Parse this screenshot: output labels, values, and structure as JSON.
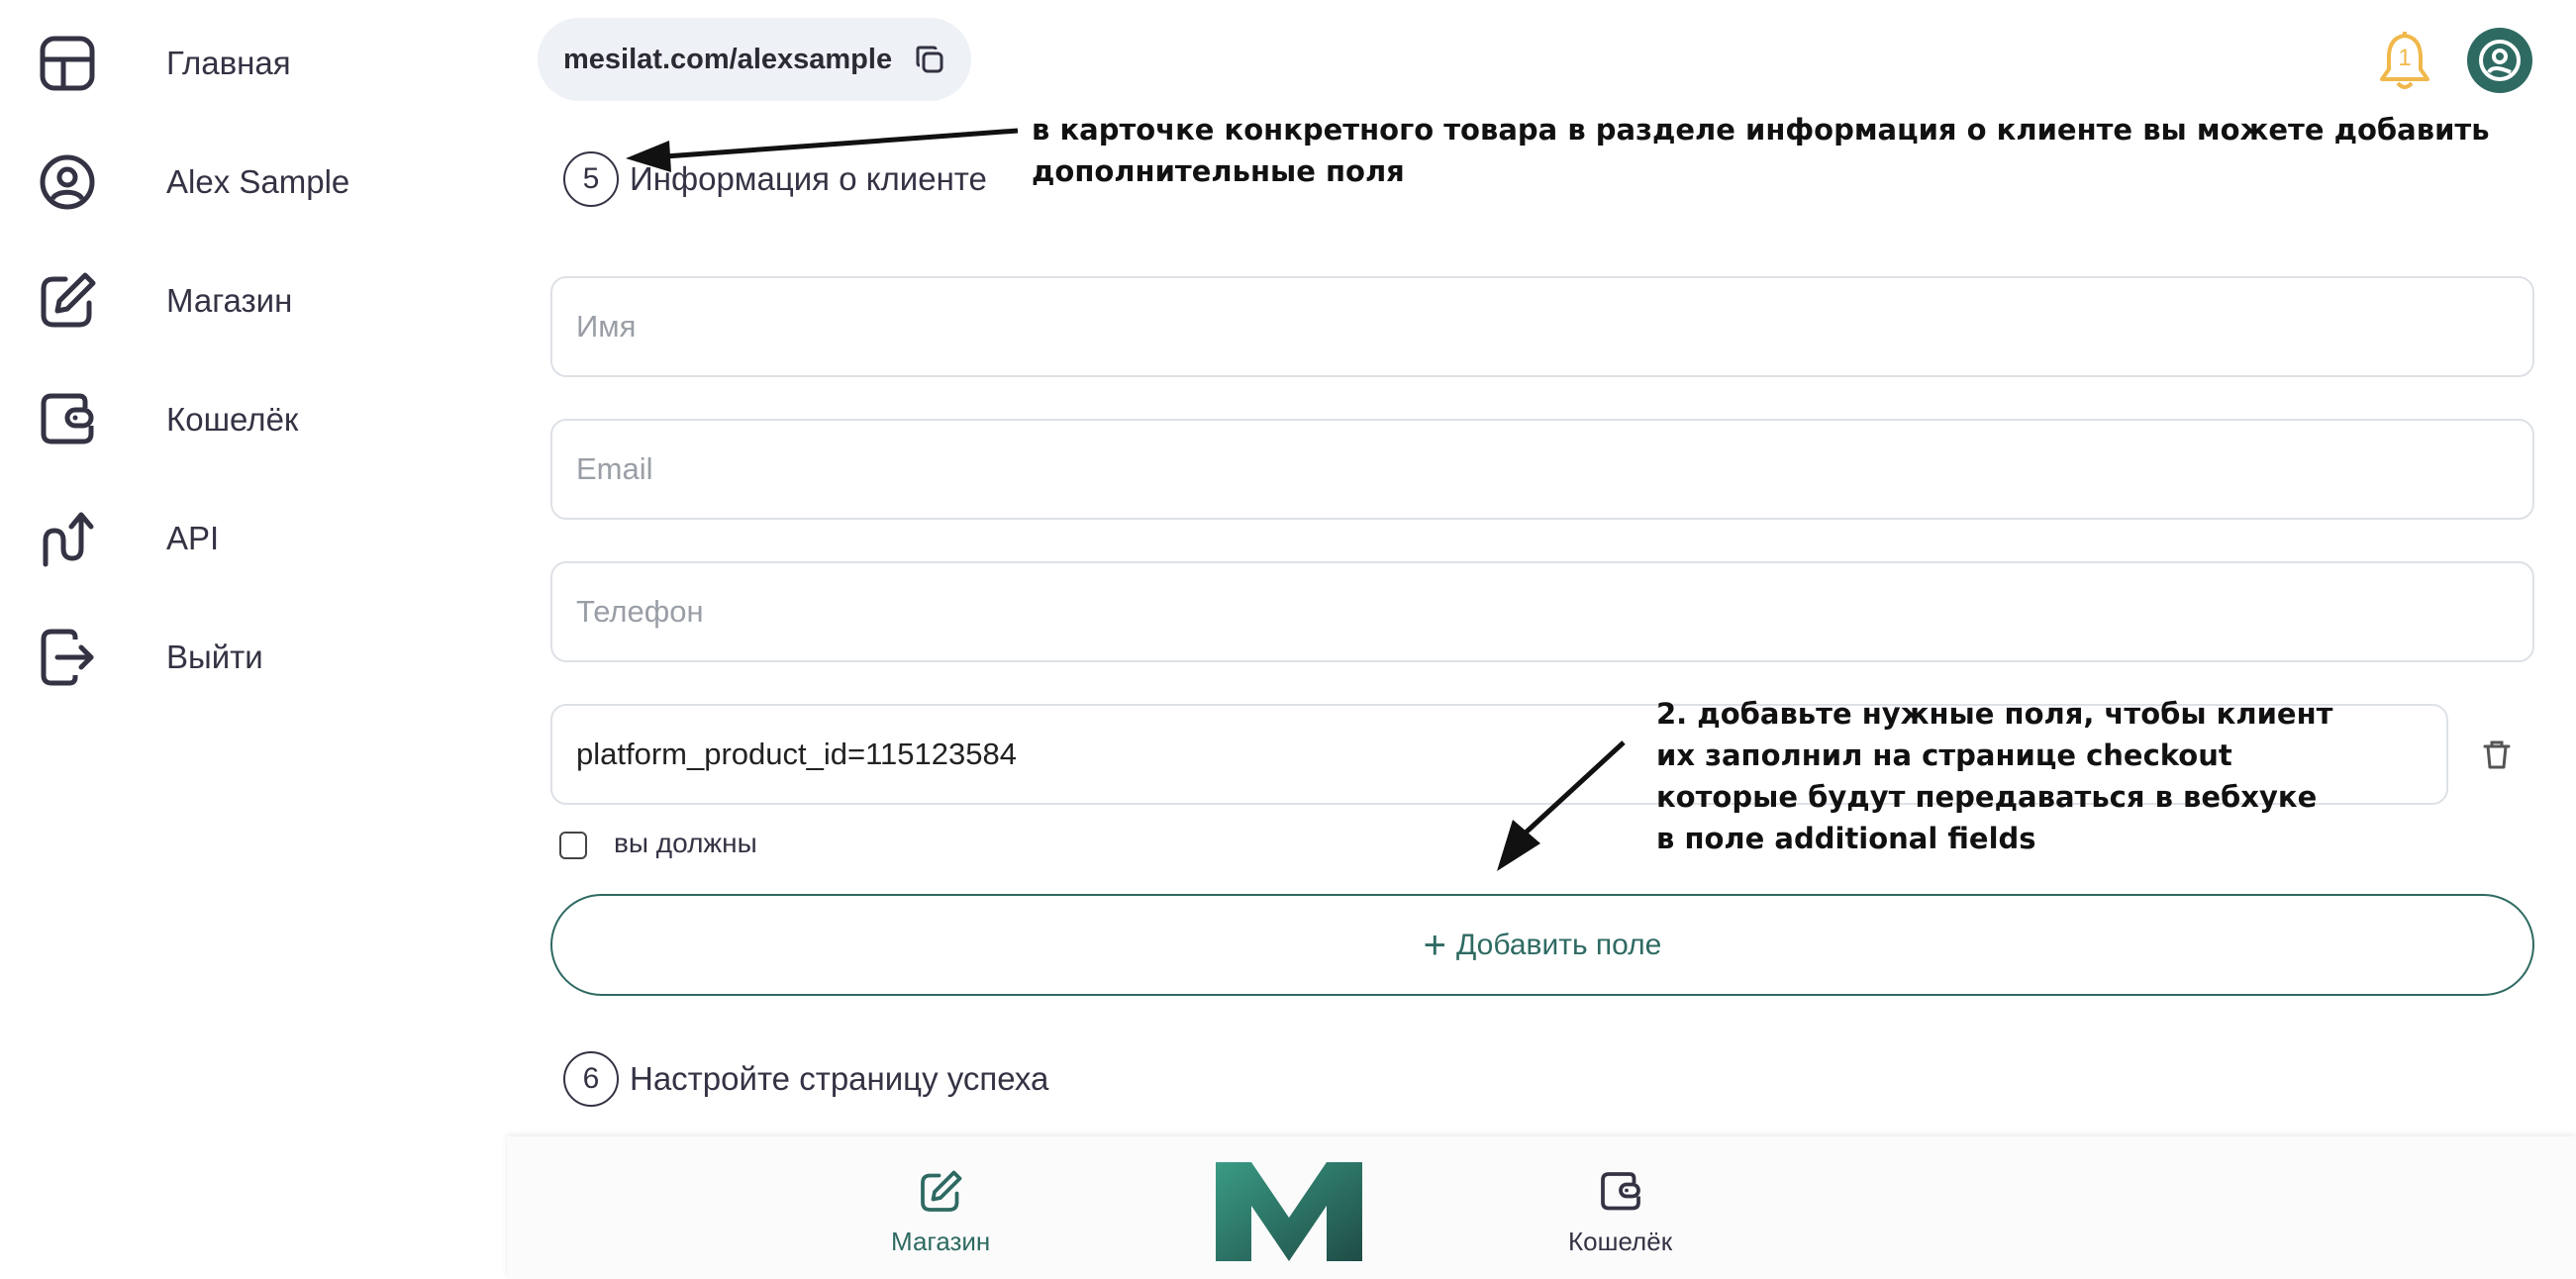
{
  "sidebar": {
    "items": [
      {
        "label": "Главная",
        "icon": "layout-dashboard-icon"
      },
      {
        "label": "Alex Sample",
        "icon": "user-circle-icon"
      },
      {
        "label": "Магазин",
        "icon": "edit-pen-icon"
      },
      {
        "label": "Кошелёк",
        "icon": "wallet-icon"
      },
      {
        "label": "API",
        "icon": "api-arrow-icon"
      },
      {
        "label": "Выйти",
        "icon": "logout-icon"
      }
    ]
  },
  "header": {
    "url": "mesilat.com/alexsample",
    "notification_count": "1"
  },
  "section5": {
    "number": "5",
    "title": "Информация о клиенте",
    "fields": {
      "name_placeholder": "Имя",
      "email_placeholder": "Email",
      "phone_placeholder": "Телефон",
      "custom_value": "platform_product_id=115123584"
    },
    "required_label": "вы должны",
    "add_field_label": "Добавить поле"
  },
  "section6": {
    "number": "6",
    "title": "Настройте страницу успеха"
  },
  "annotations": {
    "top": [
      "в карточке конкретного товара в разделе информация о клиенте вы можете добавить",
      "дополнительные поля"
    ],
    "middle": [
      "2. добавьте нужные поля, чтобы клиент",
      "их заполнил на странице checkout",
      "которые будут передаваться в вебхуке",
      "в поле additional fields"
    ]
  },
  "bottom_nav": {
    "shop_label": "Магазин",
    "wallet_label": "Кошелёк"
  },
  "colors": {
    "accent": "#2e6a62",
    "bell": "#f0b84a",
    "text": "#333344"
  }
}
